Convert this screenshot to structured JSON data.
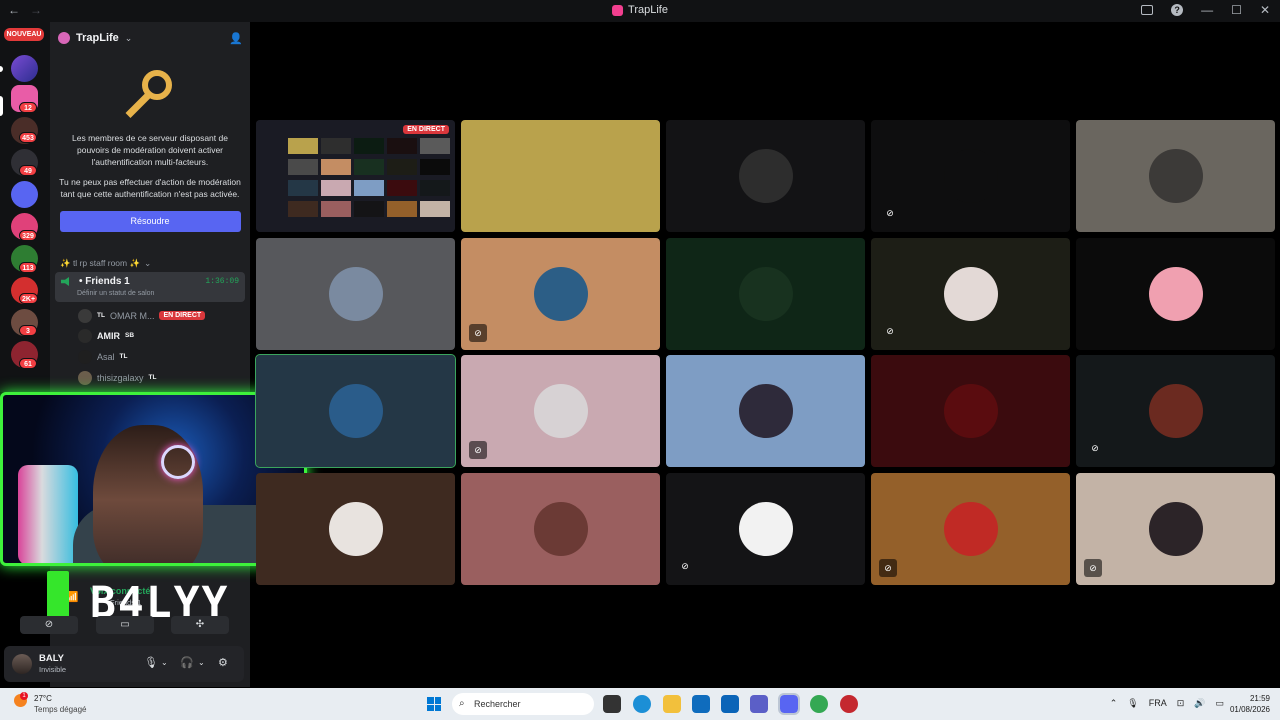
{
  "window": {
    "title": "TrapLife",
    "nav_back": "←",
    "nav_forward": "→"
  },
  "rail": {
    "new_label": "NOUVEAU",
    "badges": [
      "12",
      "49",
      "453",
      "329",
      "113",
      "2K+",
      "3",
      "61"
    ]
  },
  "guild": {
    "name": "TrapLife"
  },
  "mfa_notice": {
    "line1": "Les membres de ce serveur disposant de pouvoirs de modération doivent activer l'authentification multi-facteurs.",
    "line2": "Tu ne peux pas effectuer d'action de modération tant que cette authentification n'est pas activée.",
    "button": "Résoudre"
  },
  "category": {
    "label": "✨ tl rp staff room ✨"
  },
  "voice_channel": {
    "name": "• Friends 1",
    "timer": "1:36:09",
    "status_placeholder": "Définir un statut de salon"
  },
  "voice_members": [
    {
      "name": "OMAR M...",
      "tag": "TL",
      "badge": "EN DIRECT"
    },
    {
      "name": "AMIR",
      "tag": "SB"
    },
    {
      "name": "Asal",
      "tag": "TL"
    },
    {
      "name": "thisizgalaxy",
      "tag": "TL"
    }
  ],
  "stream_overlay": {
    "name": "B4LYY"
  },
  "voice_status": {
    "label": "Voix connectée",
    "sub": "Friends 1"
  },
  "user": {
    "name": "BALY",
    "status": "Invisible"
  },
  "grid": {
    "live_label": "EN DIRECT",
    "tiles": [
      {
        "color": "#1f1f22",
        "avatar": "#2b2b35",
        "live": true,
        "muted": false
      },
      {
        "color": "#b9a24c",
        "avatar": "#b9a24c",
        "muted": false
      },
      {
        "color": "#131315",
        "avatar": "#2d2d2d",
        "muted": false
      },
      {
        "color": "#0e0e0f",
        "avatar": "#0e0e0f",
        "muted": true
      },
      {
        "color": "#6a665f",
        "avatar": "#3c3a38",
        "muted": false
      },
      {
        "color": "#57585c",
        "avatar": "#7a8aa0",
        "muted": false
      },
      {
        "color": "#c48d63",
        "avatar": "#2c5e86",
        "muted": true,
        "boxed": true
      },
      {
        "color": "#0f2617",
        "avatar": "#18321f",
        "muted": false
      },
      {
        "color": "#1d1e16",
        "avatar": "#e3d9d6",
        "muted": true
      },
      {
        "color": "#0b0b0b",
        "avatar": "#f0a0b0",
        "muted": false
      },
      {
        "color": "#243746",
        "avatar": "#2a5c8a",
        "muted": false,
        "speaking": true
      },
      {
        "color": "#c9a9b1",
        "avatar": "#d7d2d4",
        "muted": true,
        "boxed": true
      },
      {
        "color": "#7e9dc4",
        "avatar": "#2e2a3a",
        "muted": false
      },
      {
        "color": "#3b0b0e",
        "avatar": "#5a0c0f",
        "muted": false
      },
      {
        "color": "#14181a",
        "avatar": "#6b2a20",
        "muted": true
      },
      {
        "color": "#3e2a20",
        "avatar": "#e8e3df",
        "muted": false
      },
      {
        "color": "#9a5f5f",
        "avatar": "#6b3a35",
        "muted": false
      },
      {
        "color": "#141416",
        "avatar": "#f2f2f2",
        "muted": true
      },
      {
        "color": "#94602a",
        "avatar": "#c02a25",
        "muted": true,
        "boxed": true
      },
      {
        "color": "#c3b3a6",
        "avatar": "#2c2428",
        "muted": true,
        "boxed": true
      }
    ]
  },
  "taskbar": {
    "weather_temp": "27°C",
    "weather_desc": "Temps dégagé",
    "weather_alert": "1",
    "search_placeholder": "Rechercher",
    "language": "FRA",
    "time": "21:59",
    "date": "01/08/2026"
  }
}
